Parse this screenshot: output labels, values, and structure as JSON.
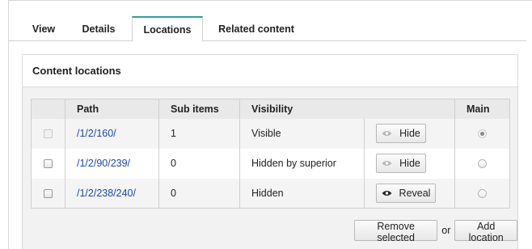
{
  "tabs": [
    {
      "label": "View",
      "active": false
    },
    {
      "label": "Details",
      "active": false
    },
    {
      "label": "Locations",
      "active": true
    },
    {
      "label": "Related content",
      "active": false
    }
  ],
  "panel": {
    "title": "Content locations"
  },
  "table": {
    "columns": [
      "",
      "Path",
      "Sub items",
      "Visibility",
      "",
      "Main"
    ],
    "rows": [
      {
        "checkbox_enabled": false,
        "path": "/1/2/160/",
        "sub_items": "1",
        "visibility": "Visible",
        "action_label": "Hide",
        "action_enabled": true,
        "action_icon": "eye-icon",
        "main": true
      },
      {
        "checkbox_enabled": true,
        "path": "/1/2/90/239/",
        "sub_items": "0",
        "visibility": "Hidden by superior",
        "action_label": "Hide",
        "action_enabled": true,
        "action_icon": "eye-icon",
        "main": false
      },
      {
        "checkbox_enabled": true,
        "path": "/1/2/238/240/",
        "sub_items": "0",
        "visibility": "Hidden",
        "action_label": "Reveal",
        "action_enabled": true,
        "action_icon": "eye-icon",
        "main": false
      }
    ]
  },
  "actions": {
    "remove_selected": "Remove selected",
    "or": "or",
    "add_location": "Add location"
  },
  "colors": {
    "active_tab_accent": "#2f9ea0",
    "link": "#1d49a8"
  }
}
